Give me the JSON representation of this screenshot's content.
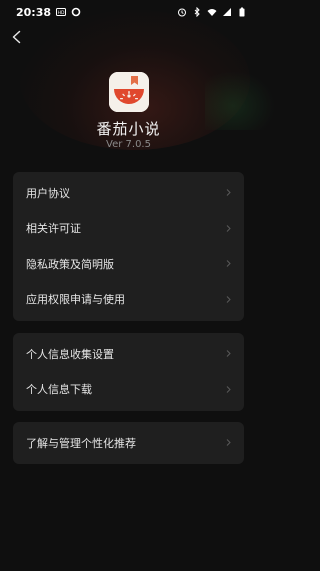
{
  "status_bar": {
    "time": "20:38",
    "left_icons": [
      "hd-icon",
      "circle-notification-icon"
    ],
    "right_icons": [
      "alarm-icon",
      "bluetooth-icon",
      "wifi-icon",
      "signal-icon",
      "battery-icon"
    ]
  },
  "header": {
    "back_icon": "chevron-left-icon"
  },
  "app": {
    "name": "番茄小说",
    "version": "Ver 7.0.5",
    "icon_colors": {
      "background": "#f5f0ea",
      "tomato": "#e0482e",
      "bookmark": "#e36f48"
    }
  },
  "groups": [
    {
      "items": [
        {
          "label": "用户协议"
        },
        {
          "label": "相关许可证"
        },
        {
          "label": "隐私政策及简明版"
        },
        {
          "label": "应用权限申请与使用"
        }
      ]
    },
    {
      "items": [
        {
          "label": "个人信息收集设置"
        },
        {
          "label": "个人信息下载"
        }
      ]
    },
    {
      "items": [
        {
          "label": "了解与管理个性化推荐"
        }
      ]
    }
  ]
}
